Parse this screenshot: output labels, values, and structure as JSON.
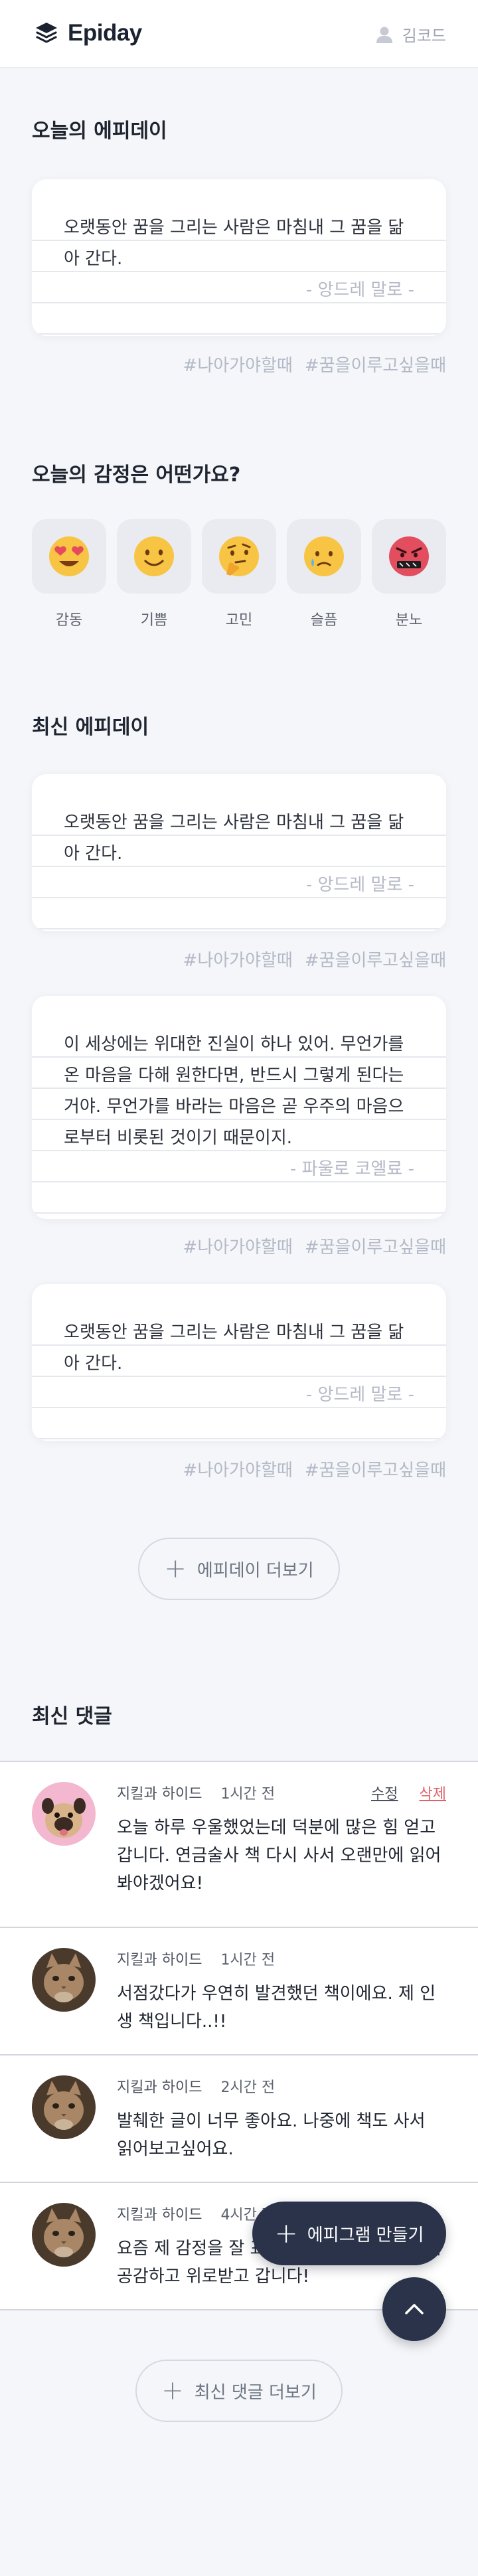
{
  "header": {
    "logo_text": "Epiday",
    "user_name": "김코드"
  },
  "today": {
    "title": "오늘의 에피데이",
    "card": {
      "text": "오랫동안 꿈을 그리는 사람은 마침내 그 꿈을 닮아 간다.",
      "author": "- 앙드레 말로 -"
    },
    "tags": [
      "#나아가야할때",
      "#꿈을이루고싶을때"
    ]
  },
  "emotion": {
    "title": "오늘의 감정은 어떤가요?",
    "items": [
      {
        "label": "감동",
        "icon": "heart-eyes-emoji-icon"
      },
      {
        "label": "기쁨",
        "icon": "smile-emoji-icon"
      },
      {
        "label": "고민",
        "icon": "thinking-emoji-icon"
      },
      {
        "label": "슬픔",
        "icon": "sad-emoji-icon"
      },
      {
        "label": "분노",
        "icon": "angry-emoji-icon"
      }
    ]
  },
  "recent": {
    "title": "최신 에피데이",
    "cards": [
      {
        "text": "오랫동안 꿈을 그리는 사람은 마침내 그 꿈을 닮아 간다.",
        "author": "- 앙드레 말로 -",
        "tags": [
          "#나아가야할때",
          "#꿈을이루고싶을때"
        ]
      },
      {
        "text": "이 세상에는 위대한 진실이 하나 있어. 무언가를 온 마음을 다해 원한다면, 반드시 그렇게 된다는 거야. 무언가를 바라는 마음은 곧 우주의 마음으로부터 비롯된 것이기 때문이지.",
        "author": "- 파울로 코엘료 -",
        "tags": [
          "#나아가야할때",
          "#꿈을이루고싶을때"
        ]
      },
      {
        "text": "오랫동안 꿈을 그리는 사람은 마침내 그 꿈을 닮아 간다.",
        "author": "- 앙드레 말로 -",
        "tags": [
          "#나아가야할때",
          "#꿈을이루고싶을때"
        ]
      }
    ],
    "more_label": "에피데이 더보기"
  },
  "comments": {
    "title": "최신 댓글",
    "items": [
      {
        "author": "지킬과 하이드",
        "time": "1시간 전",
        "text": "오늘 하루 우울했었는데 덕분에 많은 힘 얻고 갑니다. 연금술사 책 다시 사서 오랜만에 읽어봐야겠어요!",
        "edit": "수정",
        "delete": "삭제"
      },
      {
        "author": "지킬과 하이드",
        "time": "1시간 전",
        "text": "서점갔다가 우연히 발견했던 책이에요. 제 인생 책입니다..!!"
      },
      {
        "author": "지킬과 하이드",
        "time": "2시간 전",
        "text": "발췌한 글이 너무 좋아요. 나중에 책도 사서 읽어보고싶어요."
      },
      {
        "author": "지킬과 하이드",
        "time": "4시간 전",
        "text": "요즘 제 감정을 잘 표현해주는 글이에요. 글에 공감하고 위로받고 갑니다!"
      }
    ],
    "more_label": "최신 댓글 더보기"
  },
  "fab": {
    "create_label": "에피그램 만들기"
  },
  "colors": {
    "primary": "#2a3349",
    "delete": "#e0626b",
    "muted": "#b5bac6",
    "background": "#f5f6f9"
  }
}
